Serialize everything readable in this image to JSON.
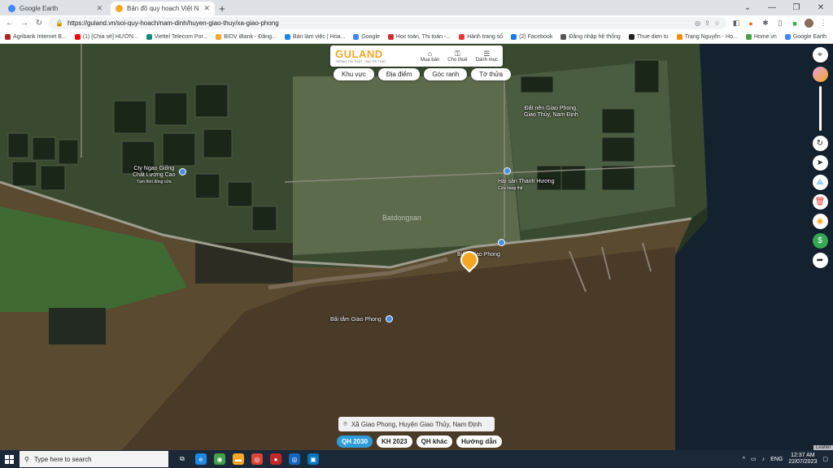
{
  "browser": {
    "tabs": [
      {
        "title": "Google Earth",
        "favicon_color": "#4285f4"
      },
      {
        "title": "Bản đồ quy hoạch Việt Nam, tra...",
        "favicon_color": "#f5a623"
      }
    ],
    "new_tab": "+",
    "url": "https://guland.vn/soi-quy-hoach/nam-dinh/huyen-giao-thuy/xa-giao-phong",
    "bookmarks": [
      {
        "label": "Agribank Internet B...",
        "color": "#b22222"
      },
      {
        "label": "(1) [Chia sẻ] HƯỚN...",
        "color": "#ff0000"
      },
      {
        "label": "Viettel Telecom Por...",
        "color": "#128a7e"
      },
      {
        "label": "BIDV iBank - Đăng...",
        "color": "#f5a623"
      },
      {
        "label": "Bàn làm việc | Hóa...",
        "color": "#1e88e5"
      },
      {
        "label": "Google",
        "color": "#4285f4"
      },
      {
        "label": "Học toán, Thi toán -...",
        "color": "#d32f2f"
      },
      {
        "label": "Hành trang số",
        "color": "#e53935"
      },
      {
        "label": "(2) Facebook",
        "color": "#1877f2"
      },
      {
        "label": "Đăng nhập hệ thống",
        "color": "#555555"
      },
      {
        "label": "Thue dien tu",
        "color": "#222222"
      },
      {
        "label": "Trạng Nguyên - Họ...",
        "color": "#fb8c00"
      },
      {
        "label": "Home.vn",
        "color": "#43a047"
      },
      {
        "label": "Google Earth",
        "color": "#4285f4"
      }
    ]
  },
  "guland": {
    "brand": "GULAND",
    "slogan": "THÔNG TIN THẬT · GIÁ TRỊ THẬT",
    "menu": [
      {
        "label": "Mua bán",
        "icon": "home-icon"
      },
      {
        "label": "Cho thuê",
        "icon": "key-icon"
      },
      {
        "label": "Danh mục",
        "icon": "menu-icon"
      }
    ],
    "filters": [
      "Khu vực",
      "Địa điểm",
      "Góc ranh",
      "Tờ thửa"
    ]
  },
  "map_labels": {
    "place1": "Đất nền Giao Phong,",
    "place1b": "Giao Thủy, Nam Định",
    "place2": "Cty Ngao Giống",
    "place2b": "Chất Lượng Cao",
    "place2c": "Tạm thời đóng cửa",
    "place3": "Hải sản Thanh Hương",
    "place3b": "Cửa hàng thịt",
    "place4": "Bãi tắm Giao Phong",
    "place5": "Biển Giao Phong",
    "watermark": "Batdongsan"
  },
  "location": "Xã Giao Phong, Huyện Giao Thủy, Nam Định",
  "plan_tabs": [
    {
      "label": "QH 2030",
      "active": true
    },
    {
      "label": "KH 2023",
      "active": false
    },
    {
      "label": "QH khác",
      "active": false
    },
    {
      "label": "Hướng dẫn",
      "active": false
    }
  ],
  "attribution": "Leaflet",
  "taskbar": {
    "search_placeholder": "Type here to search",
    "lang": "ENG",
    "time": "12:37 AM",
    "date": "22/07/2023"
  }
}
